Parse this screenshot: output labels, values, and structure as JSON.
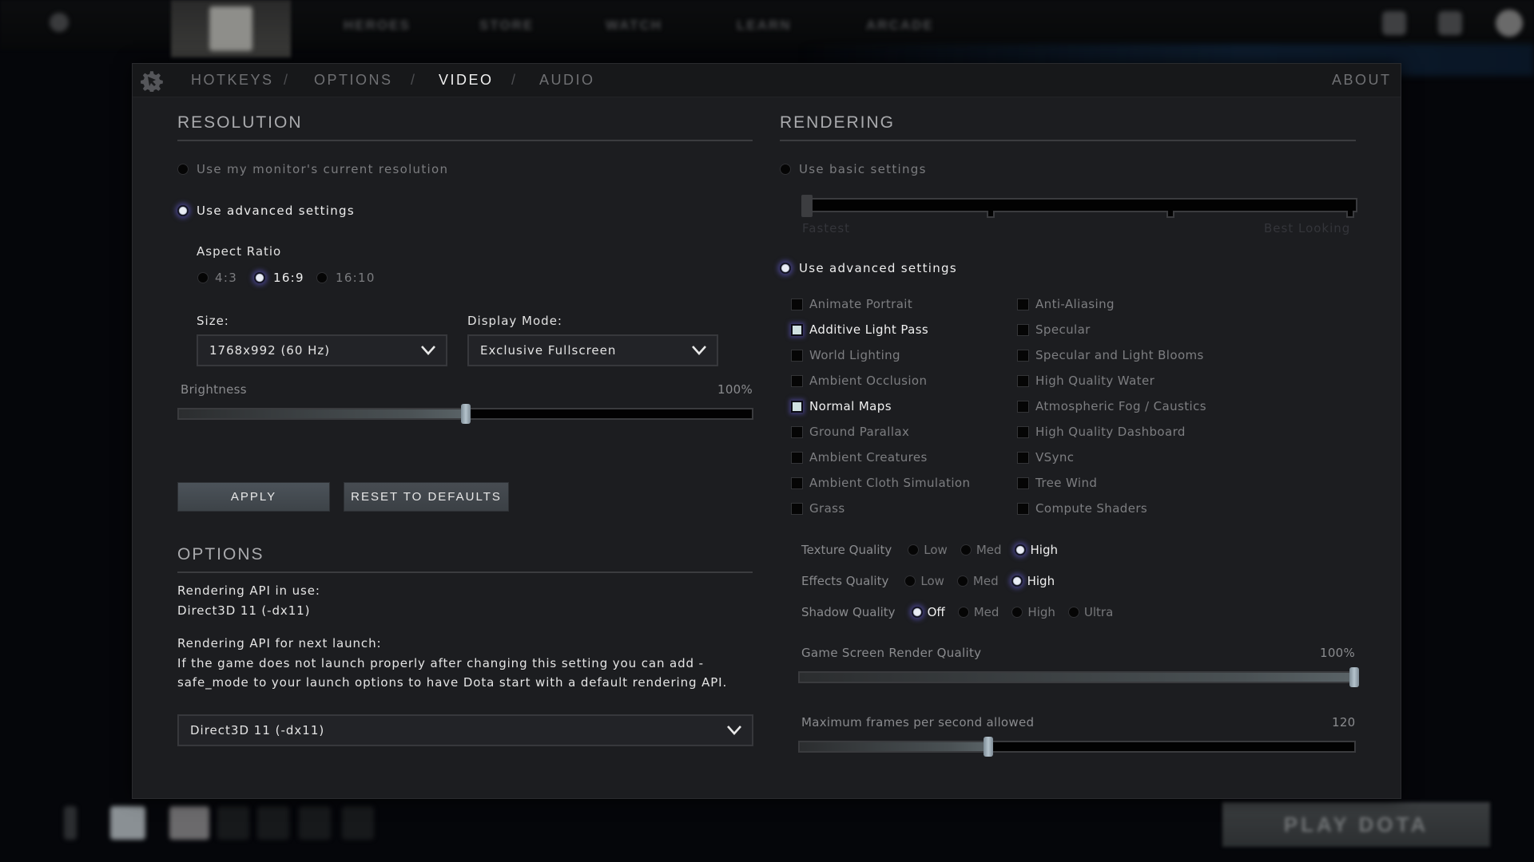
{
  "background": {
    "nav_items": [
      "HEROES",
      "STORE",
      "WATCH",
      "LEARN",
      "ARCADE"
    ],
    "play_button": "PLAY DOTA"
  },
  "header": {
    "tabs": [
      {
        "label": "HOTKEYS",
        "active": false
      },
      {
        "label": "OPTIONS",
        "active": false
      },
      {
        "label": "VIDEO",
        "active": true
      },
      {
        "label": "AUDIO",
        "active": false
      }
    ],
    "separator": "/",
    "about": "ABOUT"
  },
  "resolution": {
    "title": "RESOLUTION",
    "use_monitor": {
      "label": "Use my monitor's current resolution",
      "selected": false
    },
    "use_advanced": {
      "label": "Use advanced settings",
      "selected": true
    },
    "aspect_ratio": {
      "label": "Aspect Ratio",
      "options": [
        {
          "label": "4:3",
          "selected": false
        },
        {
          "label": "16:9",
          "selected": true
        },
        {
          "label": "16:10",
          "selected": false
        }
      ]
    },
    "size": {
      "label": "Size:",
      "value": "1768x992 (60 Hz)"
    },
    "display_mode": {
      "label": "Display Mode:",
      "value": "Exclusive Fullscreen"
    },
    "brightness": {
      "label": "Brightness",
      "value_text": "100%",
      "position": 0.5
    },
    "apply": "APPLY",
    "reset": "RESET TO DEFAULTS"
  },
  "options": {
    "title": "OPTIONS",
    "api_in_use_label": "Rendering API in use:",
    "api_in_use_value": "Direct3D 11 (-dx11)",
    "api_next_label": "Rendering API for next launch:",
    "api_next_help": "If the game does not launch properly after changing this setting you can add -safe_mode to your launch options to have Dota start with a default rendering API.",
    "api_next_value": "Direct3D 11 (-dx11)"
  },
  "rendering": {
    "title": "RENDERING",
    "use_basic": {
      "label": "Use basic settings",
      "selected": false
    },
    "basic_slider": {
      "min_label": "Fastest",
      "max_label": "Best Looking",
      "position": 0
    },
    "use_advanced": {
      "label": "Use advanced settings",
      "selected": true
    },
    "checkboxes_left": [
      {
        "label": "Animate Portrait",
        "checked": false
      },
      {
        "label": "Additive Light Pass",
        "checked": true
      },
      {
        "label": "World Lighting",
        "checked": false
      },
      {
        "label": "Ambient Occlusion",
        "checked": false
      },
      {
        "label": "Normal Maps",
        "checked": true
      },
      {
        "label": "Ground Parallax",
        "checked": false
      },
      {
        "label": "Ambient Creatures",
        "checked": false
      },
      {
        "label": "Ambient Cloth Simulation",
        "checked": false
      },
      {
        "label": "Grass",
        "checked": false
      }
    ],
    "checkboxes_right": [
      {
        "label": "Anti-Aliasing",
        "checked": false
      },
      {
        "label": "Specular",
        "checked": false
      },
      {
        "label": "Specular and Light Blooms",
        "checked": false
      },
      {
        "label": "High Quality Water",
        "checked": false
      },
      {
        "label": "Atmospheric Fog / Caustics",
        "checked": false
      },
      {
        "label": "High Quality Dashboard",
        "checked": false
      },
      {
        "label": "VSync",
        "checked": false
      },
      {
        "label": "Tree Wind",
        "checked": false
      },
      {
        "label": "Compute Shaders",
        "checked": false
      }
    ],
    "quality": [
      {
        "label": "Texture Quality",
        "options": [
          "Low",
          "Med",
          "High"
        ],
        "selected": "High"
      },
      {
        "label": "Effects Quality",
        "options": [
          "Low",
          "Med",
          "High"
        ],
        "selected": "High"
      },
      {
        "label": "Shadow Quality",
        "options": [
          "Off",
          "Med",
          "High",
          "Ultra"
        ],
        "selected": "Off"
      }
    ],
    "render_quality": {
      "label": "Game Screen Render Quality",
      "value_text": "100%",
      "position": 1.0
    },
    "max_fps": {
      "label": "Maximum frames per second allowed",
      "value_text": "120",
      "position": 0.34
    }
  }
}
